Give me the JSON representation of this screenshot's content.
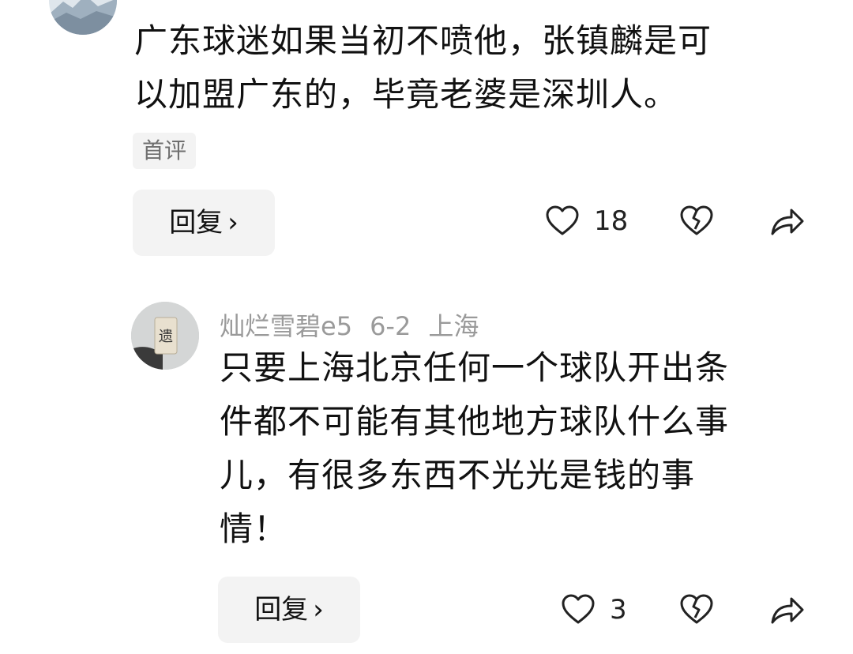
{
  "comment1": {
    "text": "广东球迷如果当初不喷他，张镇麟是可以加盟广东的，毕竟老婆是深圳人。",
    "line1": "广东球迷如果当初不喷他，张镇麟是可",
    "line2": "以加盟广东的，毕竟老婆是深圳人。",
    "tag": "首评",
    "reply_label": "回复",
    "likes": "18"
  },
  "comment2": {
    "username": "灿烂雪碧e5",
    "date": "6-2",
    "location": "上海",
    "avatar_text": "遗",
    "line1": "只要上海北京任何一个球队开出条",
    "line2": "件都不可能有其他地方球队什么事",
    "line3": "儿，有很多东西不光光是钱的事",
    "line4": "情！",
    "reply_label": "回复",
    "likes": "3"
  },
  "icons": {
    "like": "heart-outline-icon",
    "dislike": "broken-heart-icon",
    "share": "share-arrow-icon",
    "reply_chevron": "chevron-right-icon"
  },
  "colors": {
    "text": "#111111",
    "meta": "#9a9a9a",
    "button_bg": "#f3f3f3"
  }
}
